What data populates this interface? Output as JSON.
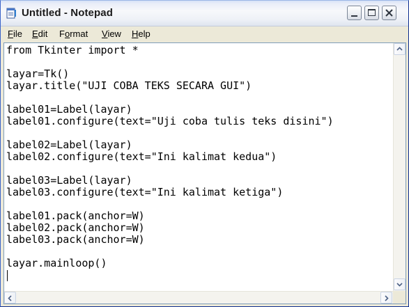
{
  "window": {
    "title": "Untitled - Notepad",
    "icon": "notepad-icon"
  },
  "titlebar_buttons": {
    "minimize_icon": "minimize-icon",
    "maximize_icon": "maximize-icon",
    "close_icon": "close-icon"
  },
  "menu": {
    "items": [
      {
        "accel": "F",
        "rest": "ile"
      },
      {
        "accel": "E",
        "rest": "dit"
      },
      {
        "accel": "o",
        "pre": "F",
        "rest": "rmat"
      },
      {
        "accel": "V",
        "rest": "iew"
      },
      {
        "accel": "H",
        "rest": "elp"
      }
    ]
  },
  "editor": {
    "content": "from Tkinter import *\n\nlayar=Tk()\nlayar.title(\"UJI COBA TEKS SECARA GUI\")\n\nlabel01=Label(layar)\nlabel01.configure(text=\"Uji coba tulis teks disini\")\n\nlabel02=Label(layar)\nlabel02.configure(text=\"Ini kalimat kedua\")\n\nlabel03=Label(layar)\nlabel03.configure(text=\"Ini kalimat ketiga\")\n\nlabel01.pack(anchor=W)\nlabel02.pack(anchor=W)\nlabel03.pack(anchor=W)\n\nlayar.mainloop()\n"
  },
  "scrollbars": {
    "up_icon": "arrow-up-icon",
    "down_icon": "arrow-down-icon",
    "left_icon": "arrow-left-icon",
    "right_icon": "arrow-right-icon"
  },
  "colors": {
    "close_red": "#c8402c",
    "editor_border": "#7f9db9",
    "chrome": "#ece9d8"
  }
}
